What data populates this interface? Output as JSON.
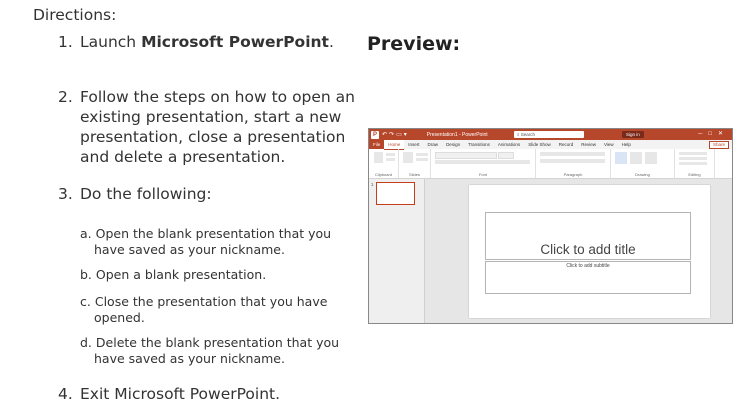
{
  "document": {
    "directions_label": "Directions:",
    "preview_label": "Preview:",
    "steps": [
      {
        "num": "1.",
        "lines": [
          "Launch ",
          "Microsoft PowerPoint",
          "."
        ]
      },
      {
        "num": "2.",
        "lines": [
          "Follow the steps on how to open an",
          "existing presentation, start a new",
          "presentation, close a presentation",
          "and delete a presentation."
        ]
      },
      {
        "num": "3.",
        "lines": [
          "Do the following:"
        ]
      },
      {
        "num": "4.",
        "lines": [
          "Exit Microsoft PowerPoint."
        ]
      }
    ],
    "substeps": [
      {
        "letter": "a.",
        "lines": [
          "Open the blank presentation that you",
          "have saved as your nickname."
        ]
      },
      {
        "letter": "b.",
        "lines": [
          "Open a blank presentation."
        ]
      },
      {
        "letter": "c.",
        "lines": [
          "Close the presentation that you have",
          "opened."
        ]
      },
      {
        "letter": "d.",
        "lines": [
          "Delete the blank presentation that you",
          "have saved as your nickname."
        ]
      }
    ]
  },
  "powerpoint": {
    "app_letter": "P",
    "doc_title": "Presentation1 - PowerPoint",
    "search_placeholder": "Search",
    "sign_in": "Sign in",
    "tabs": [
      "File",
      "Home",
      "Insert",
      "Draw",
      "Design",
      "Transitions",
      "Animations",
      "Slide Show",
      "Record",
      "Review",
      "View",
      "Help"
    ],
    "share_label": "Share",
    "groups": [
      "Clipboard",
      "Slides",
      "Font",
      "Paragraph",
      "Drawing",
      "Editing"
    ],
    "slide_number": "1",
    "title_placeholder": "Click to add title",
    "subtitle_placeholder": "Click to add subtitle"
  }
}
